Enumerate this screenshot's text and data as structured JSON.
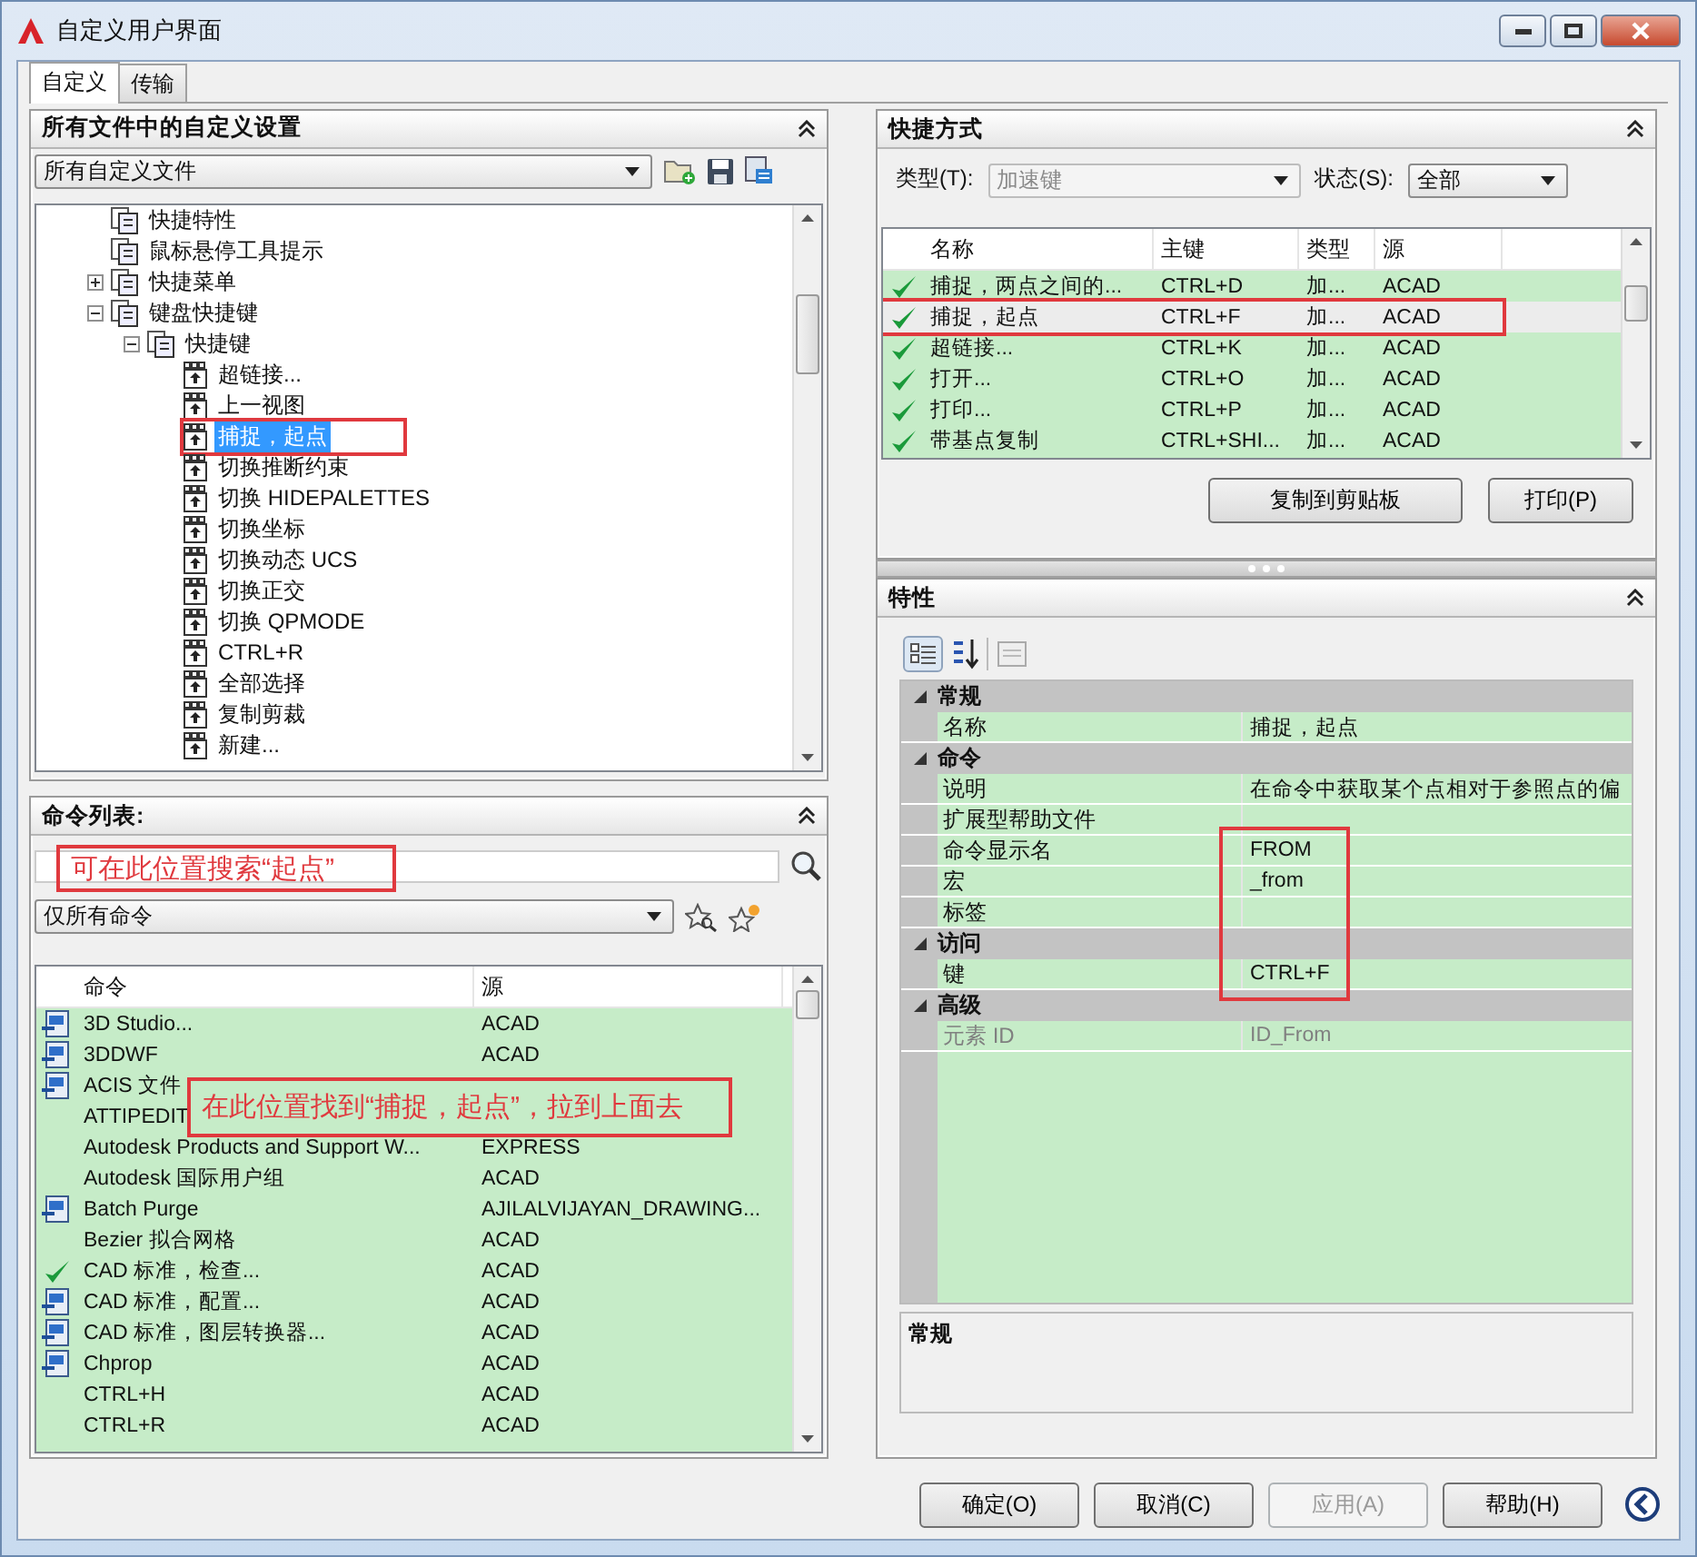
{
  "window": {
    "title": "自定义用户界面"
  },
  "tabs": [
    {
      "label": "自定义",
      "selected": true
    },
    {
      "label": "传输",
      "selected": false
    }
  ],
  "customizations_panel": {
    "title": "所有文件中的自定义设置",
    "file_filter": "所有自定义文件",
    "tree": [
      {
        "label": "快捷特性",
        "selected": false,
        "annotated": false
      },
      {
        "label": "鼠标悬停工具提示",
        "selected": false,
        "annotated": false
      },
      {
        "label": "快捷菜单",
        "expanded": false,
        "selected": false,
        "annotated": false
      },
      {
        "label": "键盘快捷键",
        "expanded": true,
        "selected": false,
        "annotated": false,
        "children": [
          {
            "label": "快捷键",
            "expanded": true,
            "selected": false,
            "annotated": false,
            "children": [
              {
                "label": "超链接...",
                "selected": false,
                "annotated": false
              },
              {
                "label": "上一视图",
                "selected": false,
                "annotated": false
              },
              {
                "label": "捕捉，起点",
                "selected": true,
                "annotated": true
              },
              {
                "label": "切换推断约束",
                "selected": false,
                "annotated": false
              },
              {
                "label": "切换 HIDEPALETTES",
                "selected": false,
                "annotated": false
              },
              {
                "label": "切换坐标",
                "selected": false,
                "annotated": false
              },
              {
                "label": "切换动态 UCS",
                "selected": false,
                "annotated": false
              },
              {
                "label": "切换正交",
                "selected": false,
                "annotated": false
              },
              {
                "label": "切换 QPMODE",
                "selected": false,
                "annotated": false
              },
              {
                "label": "CTRL+R",
                "selected": false,
                "annotated": false
              },
              {
                "label": "全部选择",
                "selected": false,
                "annotated": false
              },
              {
                "label": "复制剪裁",
                "selected": false,
                "annotated": false
              },
              {
                "label": "新建...",
                "selected": false,
                "annotated": false
              }
            ]
          }
        ]
      }
    ]
  },
  "command_list_panel": {
    "title": "命令列表:",
    "search_annotation": "可在此位置搜索“起点”",
    "filter": "仅所有命令",
    "columns": [
      "命令",
      "源"
    ],
    "rows": [
      {
        "command": "3D Studio...",
        "source": "ACAD",
        "kind": "tool"
      },
      {
        "command": "3DDWF",
        "source": "ACAD",
        "kind": "tool"
      },
      {
        "command": "ACIS 文件",
        "kind": "tool"
      },
      {
        "command": "ATTIPEDIT",
        "kind": "plain"
      },
      {
        "command": "Autodesk Products and Support W...",
        "source": "EXPRESS",
        "kind": "plain"
      },
      {
        "command": "Autodesk 国际用户组",
        "source": "ACAD",
        "kind": "plain"
      },
      {
        "command": "Batch Purge",
        "source": "AJILALVIJAYAN_DRAWING...",
        "kind": "tool"
      },
      {
        "command": "Bezier 拟合网格",
        "source": "ACAD",
        "kind": "plain"
      },
      {
        "command": "CAD 标准，检查...",
        "source": "ACAD",
        "kind": "check"
      },
      {
        "command": "CAD 标准，配置...",
        "source": "ACAD",
        "kind": "tool"
      },
      {
        "command": "CAD 标准，图层转换器...",
        "source": "ACAD",
        "kind": "tool"
      },
      {
        "command": "Chprop",
        "source": "ACAD",
        "kind": "tool"
      },
      {
        "command": "CTRL+H",
        "source": "ACAD",
        "kind": "plain"
      },
      {
        "command": "CTRL+R",
        "source": "ACAD",
        "kind": "plain"
      }
    ],
    "annotation": "在此位置找到“捕捉，起点”，拉到上面去"
  },
  "shortcuts_panel": {
    "title": "快捷方式",
    "type_label": "类型(T):",
    "type_value": "加速键",
    "type_disabled": true,
    "status_label": "状态(S):",
    "status_value": "全部",
    "columns": [
      "名称",
      "主键",
      "类型",
      "源"
    ],
    "rows": [
      {
        "name": "捕捉，两点之间的...",
        "key": "CTRL+D",
        "type": "加...",
        "source": "ACAD",
        "selected": false,
        "annotated": false
      },
      {
        "name": "捕捉，起点",
        "key": "CTRL+F",
        "type": "加...",
        "source": "ACAD",
        "selected": true,
        "annotated": true
      },
      {
        "name": "超链接...",
        "key": "CTRL+K",
        "type": "加...",
        "source": "ACAD",
        "selected": false,
        "annotated": false
      },
      {
        "name": "打开...",
        "key": "CTRL+O",
        "type": "加...",
        "source": "ACAD",
        "selected": false,
        "annotated": false
      },
      {
        "name": "打印...",
        "key": "CTRL+P",
        "type": "加...",
        "source": "ACAD",
        "selected": false,
        "annotated": false
      },
      {
        "name": "带基点复制",
        "key": "CTRL+SHI...",
        "type": "加...",
        "source": "ACAD",
        "selected": false,
        "annotated": false
      }
    ],
    "buttons": [
      "复制到剪贴板",
      "打印(P)"
    ]
  },
  "properties_panel": {
    "title": "特性",
    "categories": [
      {
        "name": "常规",
        "expanded": true,
        "rows": [
          {
            "name": "名称",
            "value": "捕捉，起点",
            "disabled": false
          }
        ]
      },
      {
        "name": "命令",
        "expanded": true,
        "rows": [
          {
            "name": "说明",
            "value": "在命令中获取某个点相对于参照点的偏",
            "disabled": false
          },
          {
            "name": "扩展型帮助文件",
            "disabled": false
          },
          {
            "name": "命令显示名",
            "value": "FROM",
            "disabled": false
          },
          {
            "name": "宏",
            "value": "_from",
            "disabled": false
          },
          {
            "name": "标签",
            "disabled": false
          }
        ]
      },
      {
        "name": "访问",
        "expanded": true,
        "rows": [
          {
            "name": "键",
            "value": "CTRL+F",
            "disabled": false
          }
        ]
      },
      {
        "name": "高级",
        "expanded": true,
        "rows": [
          {
            "name": "元素 ID",
            "value": "ID_From",
            "disabled": true
          }
        ]
      }
    ],
    "description_title": "常规"
  },
  "buttons": [
    {
      "label": "确定(O)",
      "disabled": false
    },
    {
      "label": "取消(C)",
      "disabled": false
    },
    {
      "label": "应用(A)",
      "disabled": true
    },
    {
      "label": "帮助(H)",
      "disabled": false
    }
  ]
}
